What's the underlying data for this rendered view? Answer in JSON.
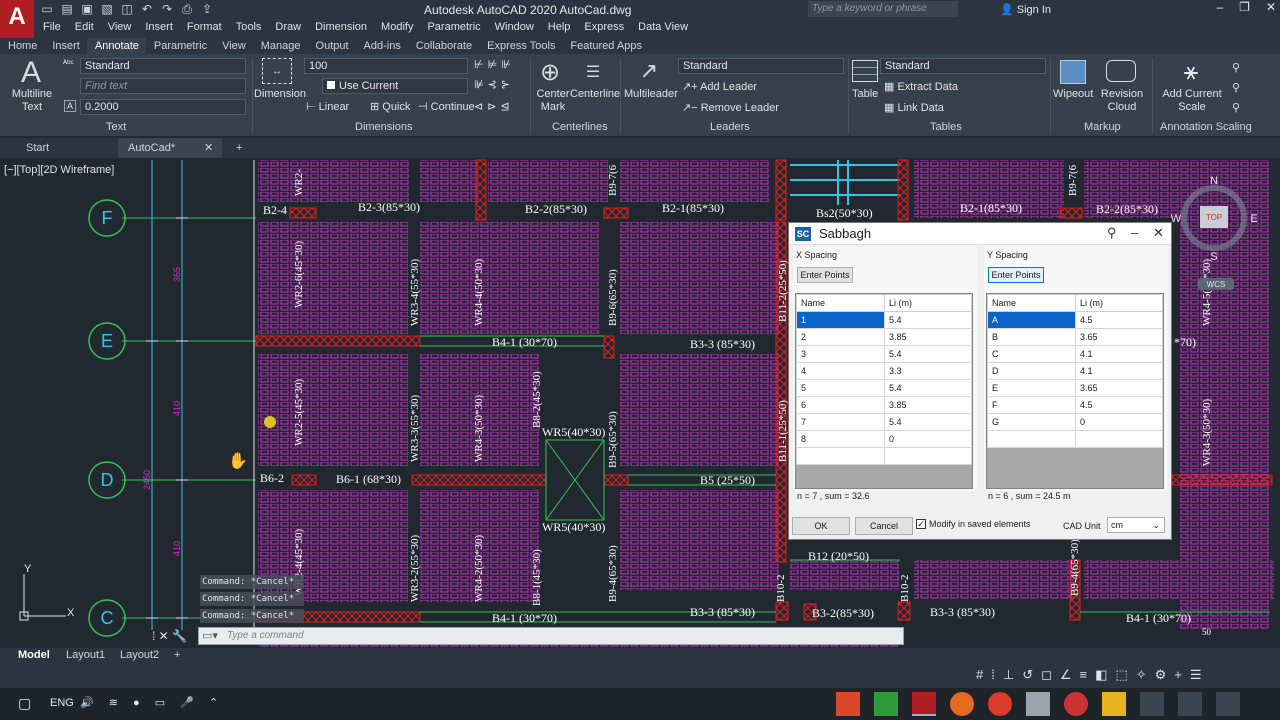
{
  "app": {
    "logo": "A",
    "title": "Autodesk AutoCAD 2020    AutoCad.dwg",
    "search_placeholder": "Type a keyword or phrase",
    "sign_in": "Sign In"
  },
  "menu": [
    "File",
    "Edit",
    "View",
    "Insert",
    "Format",
    "Tools",
    "Draw",
    "Dimension",
    "Modify",
    "Parametric",
    "Window",
    "Help",
    "Express",
    "Data View"
  ],
  "ribbon_tabs": [
    "Home",
    "Insert",
    "Annotate",
    "Parametric",
    "View",
    "Manage",
    "Output",
    "Add-ins",
    "Collaborate",
    "Express Tools",
    "Featured Apps"
  ],
  "ribbon": {
    "text_panel": {
      "multiline_text": "Multiline Text",
      "style": "Standard",
      "find_placeholder": "Find text",
      "height": "0.2000",
      "title": "Text"
    },
    "dimensions_panel": {
      "dimension": "Dimension",
      "scale": "100",
      "layer": "Use Current",
      "linear": "Linear",
      "quick": "Quick",
      "continue": "Continue",
      "title": "Dimensions"
    },
    "centerlines_panel": {
      "center_mark": "Center Mark",
      "centerline": "Centerline",
      "title": "Centerlines"
    },
    "leaders_panel": {
      "multileader": "Multileader",
      "style": "Standard",
      "add_leader": "Add Leader",
      "remove_leader": "Remove Leader",
      "title": "Leaders"
    },
    "tables_panel": {
      "table": "Table",
      "style": "Standard",
      "extract_data": "Extract Data",
      "link_data": "Link Data",
      "title": "Tables"
    },
    "markup_panel": {
      "wipeout": "Wipeout",
      "revision_cloud": "Revision Cloud",
      "title": "Markup"
    },
    "scaling_panel": {
      "add_current_scale": "Add Current Scale",
      "title": "Annotation Scaling"
    }
  },
  "file_tabs": [
    "Start",
    "AutoCad*"
  ],
  "viewport_label": "[−][Top][2D Wireframe]",
  "drawing": {
    "grid_bubbles": [
      "F",
      "E",
      "D",
      "C"
    ],
    "dims": [
      "365",
      "410",
      "2450",
      "410"
    ],
    "beam_labels": {
      "b2_4": "B2-4",
      "b2_3": "B2-3(85*30)",
      "b2_2a": "B2-2(85*30)",
      "b2_1": "B2-1(85*30)",
      "bs2": "Bs2(50*30)",
      "b2_1b": "B2-1(85*30)",
      "b2_2b": "B2-2(85*30)",
      "b4_1a": "B4-1 (30*70)",
      "b3_3a": "B3-3 (85*30)",
      "b6_2": "B6-2",
      "b6_1": "B6-1 (68*30)",
      "b5": "B5 (25*50)",
      "b12": "B12 (20*50)",
      "b4_1b": "B4-1 (30*70)",
      "b3_3b": "B3-3 (85*30)",
      "b3_2": "B3-2(85*30)",
      "b3_3c": "B3-3 (85*30)",
      "b4_1c": "B4-1 (30*70)",
      "wr5a": "WR5(40*30)",
      "wr5b": "WR5(40*30)",
      "e70": "*70)",
      "fifty": "50"
    },
    "vertical_labels": [
      "WR2-",
      "WR2-6(45*30)",
      "WR3-4(55*30)",
      "WR4-4(50*30)",
      "B9-6(65*30)",
      "B11-2(25*50)",
      "B9-7(6",
      "WR2-5(45*30)",
      "WR3-3(55*30)",
      "WR4-3(50*30)",
      "B8-2(45*30)",
      "B9-5(65*30)",
      "B11-1(25*50)",
      "WR2-4(45*30)",
      "WR3-2(55*30)",
      "WR4-2(50*30)",
      "B8-1(45*30)",
      "B9-4(65*30)",
      "B10-2",
      "B10-2",
      "B9-4(65*30)",
      "WR4-5(50*30)",
      "WR4-3(50*30)",
      "B9-7(6"
    ],
    "compass": {
      "n": "N",
      "s": "S",
      "e": "E",
      "w": "W",
      "top": "TOP",
      "wcs": "WCS"
    }
  },
  "command": {
    "history": [
      "Command: *Cancel*",
      "Command: *Cancel*",
      "Command: *Cancel*"
    ],
    "placeholder": "Type a command"
  },
  "layout_tabs": [
    "Model",
    "Layout1",
    "Layout2"
  ],
  "taskbar": {
    "lang": "ENG"
  },
  "dialog": {
    "logo": "SC",
    "title": "Sabbagh",
    "x_spacing": {
      "title": "X Spacing",
      "button": "Enter Points",
      "headers": [
        "Name",
        "Li (m)"
      ],
      "rows": [
        [
          "1",
          "5.4"
        ],
        [
          "2",
          "3.85"
        ],
        [
          "3",
          "5.4"
        ],
        [
          "4",
          "3.3"
        ],
        [
          "5",
          "5.4"
        ],
        [
          "6",
          "3.85"
        ],
        [
          "7",
          "5.4"
        ],
        [
          "8",
          "0"
        ],
        [
          "",
          ""
        ]
      ],
      "summary": "n = 7 , sum = 32.6"
    },
    "y_spacing": {
      "title": "Y Spacing",
      "button": "Enter Points",
      "headers": [
        "Name",
        "Li (m)"
      ],
      "rows": [
        [
          "A",
          "4.5"
        ],
        [
          "B",
          "3.65"
        ],
        [
          "C",
          "4.1"
        ],
        [
          "D",
          "4.1"
        ],
        [
          "E",
          "3.65"
        ],
        [
          "F",
          "4.5"
        ],
        [
          "G",
          "0"
        ],
        [
          "",
          ""
        ]
      ],
      "summary": "n = 6 , sum = 24.5 m"
    },
    "ok": "OK",
    "cancel": "Cancel",
    "modify_label": "Modify in saved elements",
    "modify_checked": true,
    "cad_unit_label": "CAD Unit",
    "cad_unit": "cm"
  },
  "colors": {
    "accent": "#0a64c8",
    "background": "#212830",
    "magenta": "#c533c5",
    "beam_red": "#e02020",
    "grid_green": "#35c255",
    "cyan": "#2fc8e0"
  }
}
